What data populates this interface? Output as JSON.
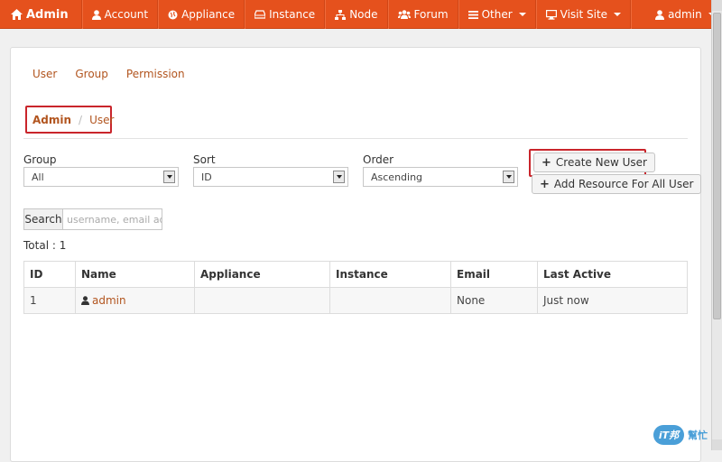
{
  "navbar": {
    "brand": "Admin",
    "items": [
      {
        "label": "Account",
        "icon": "user-icon"
      },
      {
        "label": "Appliance",
        "icon": "globe-icon"
      },
      {
        "label": "Instance",
        "icon": "hdd-icon"
      },
      {
        "label": "Node",
        "icon": "sitemap-icon"
      },
      {
        "label": "Forum",
        "icon": "group-icon"
      },
      {
        "label": "Other",
        "icon": "list-icon"
      },
      {
        "label": "Visit Site",
        "icon": "desktop-icon"
      },
      {
        "label": "admin",
        "icon": "user-icon"
      }
    ]
  },
  "subnav": [
    "User",
    "Group",
    "Permission"
  ],
  "breadcrumb": {
    "root": "Admin",
    "separator": "/",
    "current": "User"
  },
  "filters": {
    "group": {
      "label": "Group",
      "value": "All"
    },
    "sort": {
      "label": "Sort",
      "value": "ID"
    },
    "order": {
      "label": "Order",
      "value": "Ascending"
    }
  },
  "buttons": {
    "create_user": "Create New User",
    "add_resource": "Add Resource For All User"
  },
  "search": {
    "label": "Search",
    "placeholder": "username, email adc"
  },
  "total": "Total : 1",
  "table": {
    "headers": [
      "ID",
      "Name",
      "Appliance",
      "Instance",
      "Email",
      "Last Active"
    ],
    "rows": [
      {
        "id": "1",
        "name": "admin",
        "appliance": "",
        "instance": "",
        "email": "None",
        "last_active": "Just now"
      }
    ]
  },
  "colors": {
    "accent": "#e5511d",
    "link": "#b2551f",
    "highlight": "#c9252b"
  }
}
